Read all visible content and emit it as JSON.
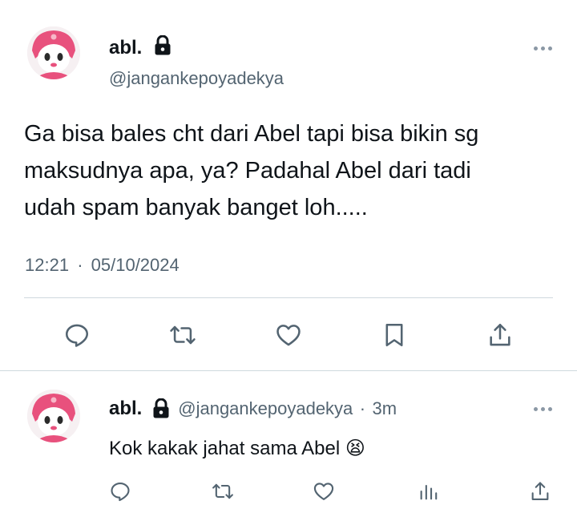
{
  "main_tweet": {
    "display_name": "abl.",
    "handle": "@jangankepoyadekya",
    "text_lines": [
      "Ga bisa bales cht dari Abel tapi bisa bikin sg",
      "maksudnya apa, ya? Padahal Abel dari tadi",
      "udah spam banyak banget loh....."
    ],
    "time": "12:21",
    "separator": "·",
    "date": "05/10/2024",
    "actions": [
      "reply-icon",
      "retweet-icon",
      "like-icon",
      "bookmark-icon",
      "share-icon"
    ]
  },
  "reply_tweet": {
    "display_name": "abl.",
    "handle": "@jangankepoyadekya",
    "separator": "·",
    "age": "3m",
    "text": "Kok kakak jahat sama Abel",
    "emoji": "😫",
    "actions": [
      "reply-icon",
      "retweet-icon",
      "like-icon",
      "views-icon",
      "share-icon"
    ]
  },
  "colors": {
    "text": "#0f1419",
    "secondary": "#536471",
    "icon": "#536471",
    "divider": "#cfd9de",
    "avatar_pink": "#e8517d"
  }
}
